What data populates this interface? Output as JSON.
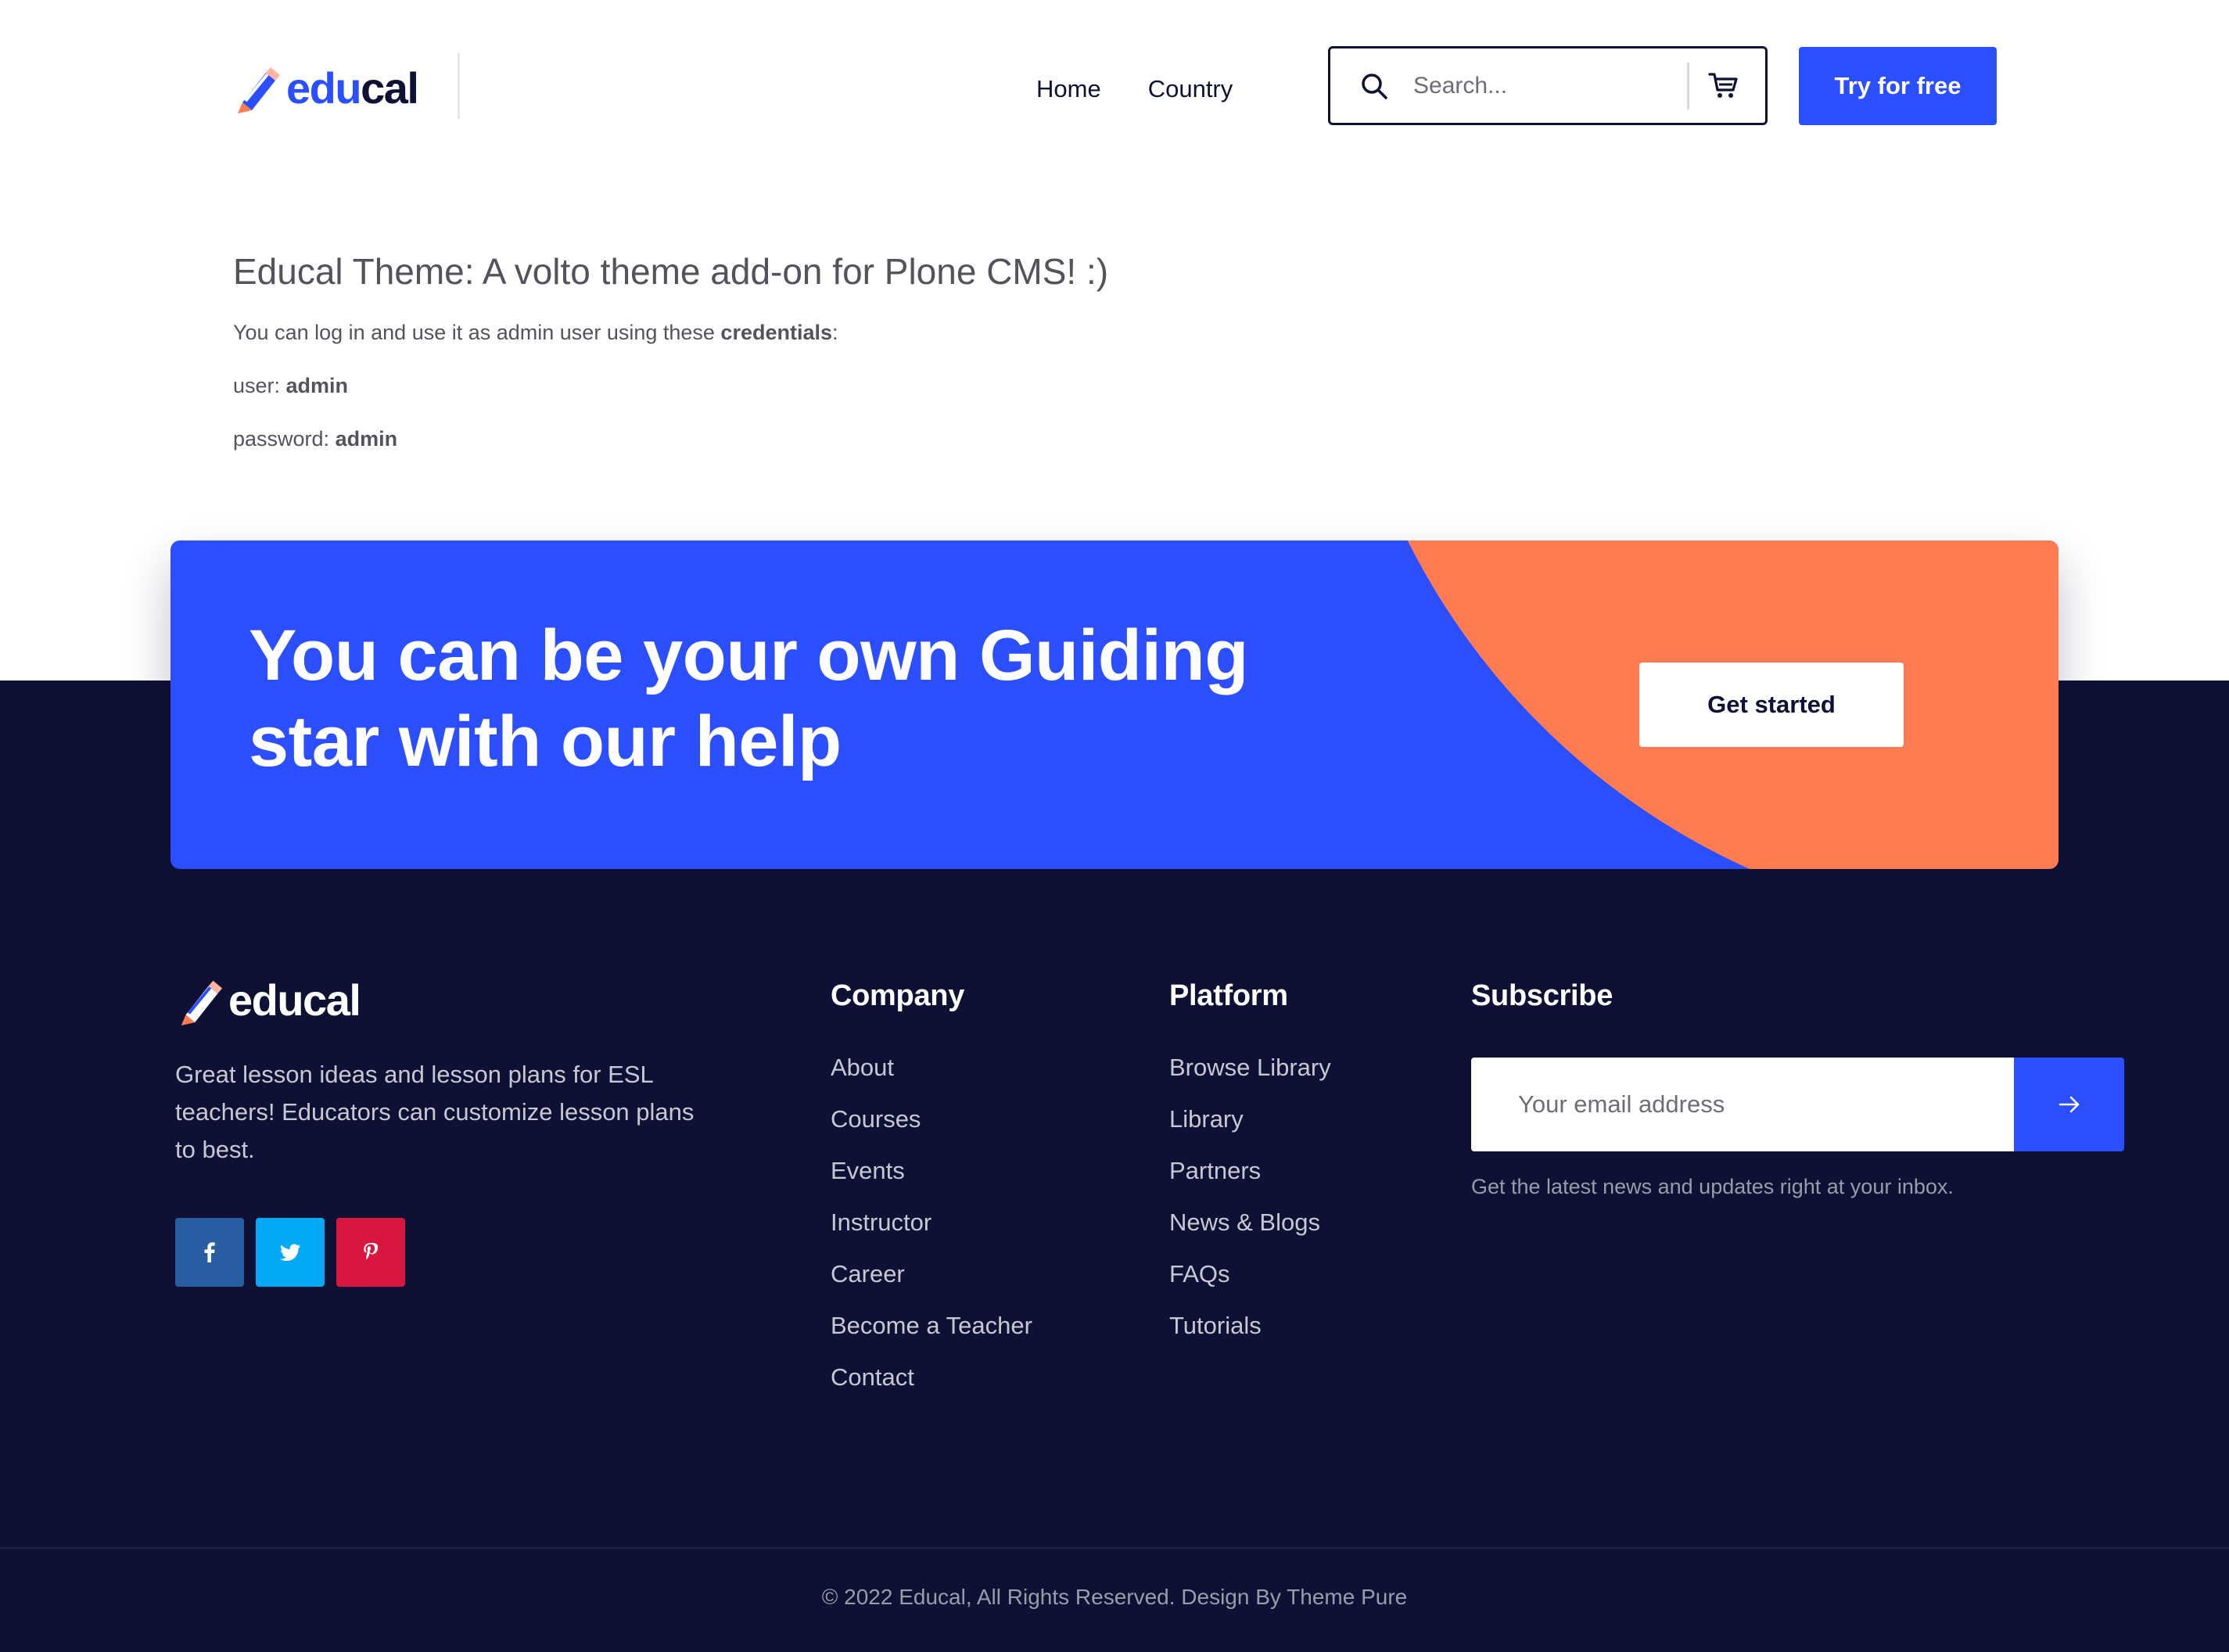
{
  "header": {
    "logo": {
      "part1": "edu",
      "part2": "cal"
    },
    "nav": [
      {
        "label": "Home"
      },
      {
        "label": "Country"
      }
    ],
    "search": {
      "placeholder": "Search..."
    },
    "try_button": "Try for free"
  },
  "main": {
    "title": "Educal Theme: A volto theme add-on for Plone CMS! :)",
    "intro_text": "You can log in and use it as admin user using these ",
    "intro_bold": "credentials",
    "intro_end": ":",
    "user_label": "user: ",
    "user_value": "admin",
    "password_label": "password: ",
    "password_value": "admin"
  },
  "cta": {
    "heading": "You can be your own Guiding star with our help",
    "button": "Get started"
  },
  "footer": {
    "logo_text": "educal",
    "description": "Great lesson ideas and lesson plans for ESL teachers! Educators can customize lesson plans to best.",
    "socials": [
      {
        "icon": "facebook-icon"
      },
      {
        "icon": "twitter-icon"
      },
      {
        "icon": "pinterest-icon"
      }
    ],
    "company": {
      "title": "Company",
      "links": [
        "About",
        "Courses",
        "Events",
        "Instructor",
        "Career",
        "Become a Teacher",
        "Contact"
      ]
    },
    "platform": {
      "title": "Platform",
      "links": [
        "Browse Library",
        "Library",
        "Partners",
        "News & Blogs",
        "FAQs",
        "Tutorials"
      ]
    },
    "subscribe": {
      "title": "Subscribe",
      "placeholder": "Your email address",
      "note": "Get the latest news and updates right at your inbox."
    },
    "copyright": "© 2022 Educal, All Rights Reserved. Design By Theme Pure"
  },
  "colors": {
    "brand_blue": "#2b4eff",
    "accent_orange": "#ff7b52",
    "dark_navy": "#0e1133"
  }
}
